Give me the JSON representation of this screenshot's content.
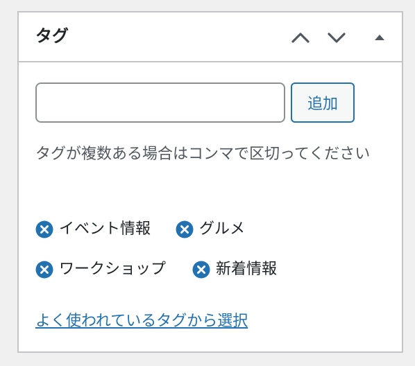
{
  "panel": {
    "title": "タグ",
    "controls": {
      "move_up_icon": "chevron-up-icon",
      "move_down_icon": "chevron-down-icon",
      "toggle_icon": "triangle-up-icon"
    }
  },
  "tag_input": {
    "value": "",
    "placeholder": ""
  },
  "add_button": {
    "label": "追加"
  },
  "help_text": "タグが複数ある場合はコンマで区切ってください",
  "tags": [
    {
      "label": "イベント情報"
    },
    {
      "label": "グルメ"
    },
    {
      "label": "ワークショップ"
    },
    {
      "label": "新着情報"
    }
  ],
  "choose_link": {
    "label": "よく使われているタグから選択"
  },
  "colors": {
    "accent": "#2271b1",
    "text": "#1d2327",
    "muted_text": "#50575e",
    "border": "#c3c4c7",
    "background": "#f0f0f1"
  }
}
